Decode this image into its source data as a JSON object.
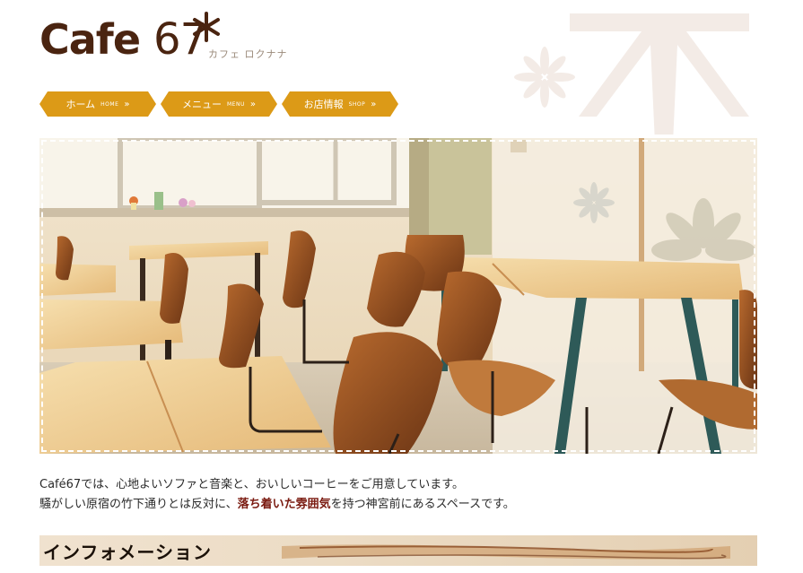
{
  "logo": {
    "brand": "Cafe ",
    "number": "67",
    "kana": "カフェ ロクナナ"
  },
  "nav": {
    "items": [
      {
        "label": "ホーム",
        "sub": "HOME",
        "arrow": "»"
      },
      {
        "label": "メニュー",
        "sub": "MENU",
        "arrow": "»"
      },
      {
        "label": "お店情報",
        "sub": "SHOP",
        "arrow": "»"
      }
    ]
  },
  "intro": {
    "line1": "Café67では、心地よいソファと音楽と、おいしいコーヒーをご用意しています。",
    "line2_before": "騒がしい原宿の竹下通りとは反対に、",
    "line2_highlight": "落ち着いた雰囲気",
    "line2_after": "を持つ神宮前にあるスペースです。"
  },
  "info": {
    "title": "インフォメーション"
  },
  "colors": {
    "brand": "#4a2410",
    "nav": "#dc9a17",
    "highlight": "#7a1a10"
  }
}
